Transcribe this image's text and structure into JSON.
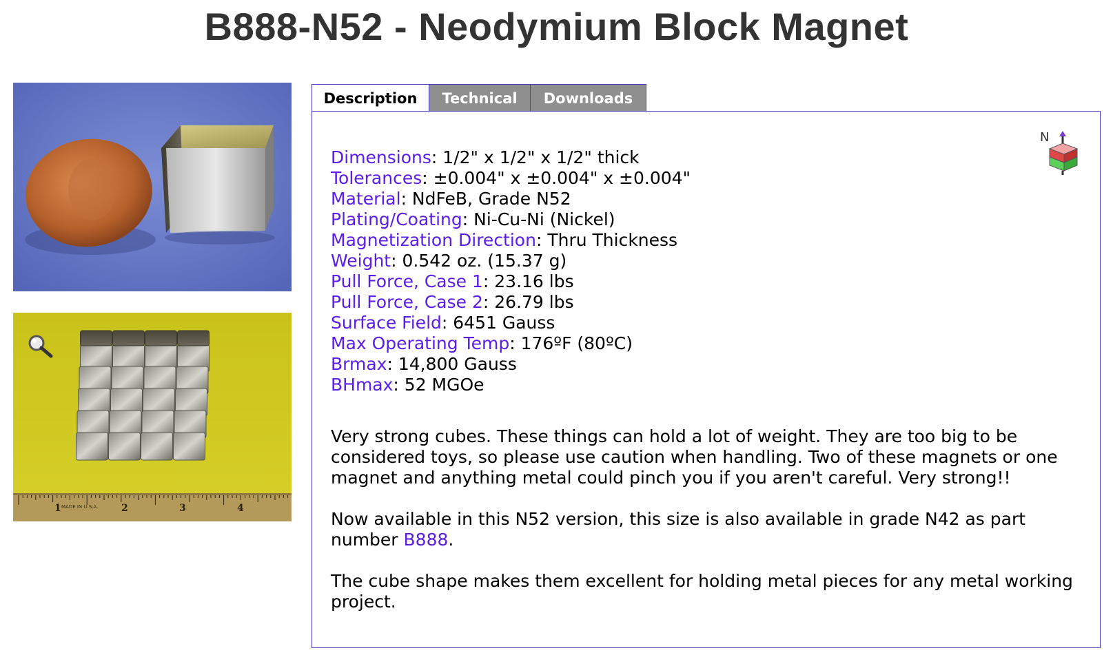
{
  "title": "B888-N52 - Neodymium Block Magnet",
  "tabs": [
    {
      "label": "Description"
    },
    {
      "label": "Technical"
    },
    {
      "label": "Downloads"
    }
  ],
  "magnet_icon": {
    "label": "N"
  },
  "specs": [
    {
      "label": "Dimensions",
      "value": ": 1/2\" x 1/2\" x 1/2\" thick"
    },
    {
      "label": "Tolerances",
      "value": ": ±0.004\" x ±0.004\" x ±0.004\""
    },
    {
      "label": "Material",
      "value": ": NdFeB, Grade N52"
    },
    {
      "label": "Plating/Coating",
      "value": ": Ni-Cu-Ni (Nickel)"
    },
    {
      "label": "Magnetization Direction",
      "value": ": Thru Thickness"
    },
    {
      "label": "Weight",
      "value": ": 0.542 oz. (15.37 g)"
    },
    {
      "label": "Pull Force, Case 1",
      "value": ": 23.16 lbs"
    },
    {
      "label": "Pull Force, Case 2",
      "value": ": 26.79 lbs"
    },
    {
      "label": "Surface Field",
      "value": ": 6451 Gauss"
    },
    {
      "label": "Max Operating Temp",
      "value": ": 176ºF (80ºC)"
    },
    {
      "label": "Brmax",
      "value": ": 14,800 Gauss"
    },
    {
      "label": "BHmax",
      "value": ": 52 MGOe"
    }
  ],
  "description": {
    "para1": "Very strong cubes. These things can hold a lot of weight. They are too big to be considered toys, so please use caution when handling. Two of these magnets or one magnet and anything metal could pinch you if you aren't careful. Very strong!!",
    "para2_before": "Now available in this N52 version, this size is also available in grade N42 as part number ",
    "para2_link": "B888",
    "para2_after": ".",
    "para3": "The cube shape makes them excellent for holding metal pieces for any metal working project."
  },
  "ruler": {
    "marks": [
      "1",
      "2",
      "3",
      "4"
    ],
    "made_in": "MADE IN U.S.A."
  },
  "colors": {
    "link": "#5a1ee8",
    "tab_border": "#4b3fc2",
    "tab_inactive": "#8f8f8f",
    "title": "#333333"
  }
}
